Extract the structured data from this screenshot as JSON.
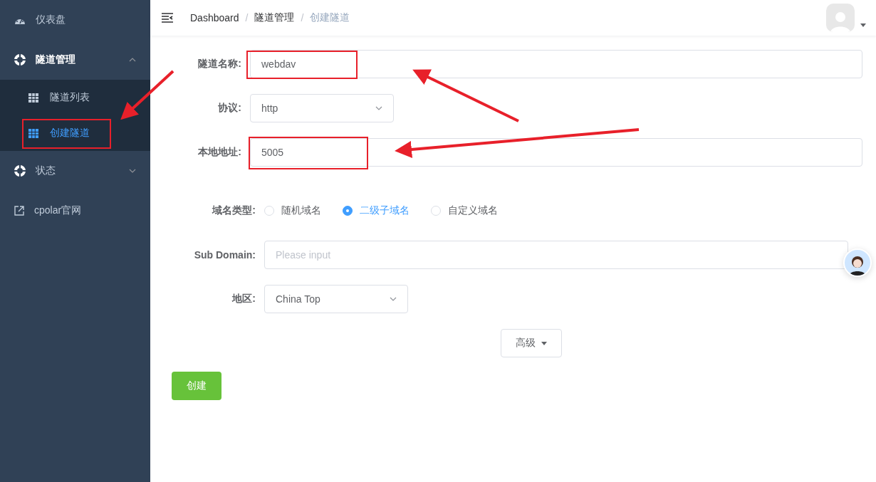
{
  "sidebar": {
    "items": [
      {
        "kind": "dashboard",
        "label": "仪表盘"
      },
      {
        "kind": "group",
        "label": "隧道管理",
        "expanded": true,
        "children": [
          {
            "label": "隧道列表",
            "selected": false
          },
          {
            "label": "创建隧道",
            "selected": true
          }
        ]
      },
      {
        "kind": "group",
        "label": "状态",
        "expanded": false
      },
      {
        "kind": "link",
        "label": "cpolar官网"
      }
    ]
  },
  "breadcrumb": [
    {
      "label": "Dashboard",
      "current": false
    },
    {
      "separator": "/",
      "label": "隧道管理",
      "current": false
    },
    {
      "separator": "/",
      "label": "创建隧道",
      "current": true
    }
  ],
  "form": {
    "fields": [
      {
        "kind": "text",
        "label": "隧道名称:",
        "value": "webdav"
      },
      {
        "kind": "select",
        "label": "协议:",
        "value": "http"
      },
      {
        "kind": "text",
        "label": "本地地址:",
        "value": "5005"
      }
    ],
    "domain_type": {
      "label": "域名类型:",
      "options": [
        {
          "label": "随机域名",
          "selected": false
        },
        {
          "label": "二级子域名",
          "selected": true
        },
        {
          "label": "自定义域名",
          "selected": false
        }
      ]
    },
    "sub_domain": {
      "label": "Sub Domain:",
      "placeholder": "Please input"
    },
    "region": {
      "label": "地区:",
      "value": "China Top"
    },
    "advanced_button": "高级",
    "create_button": "创建"
  }
}
